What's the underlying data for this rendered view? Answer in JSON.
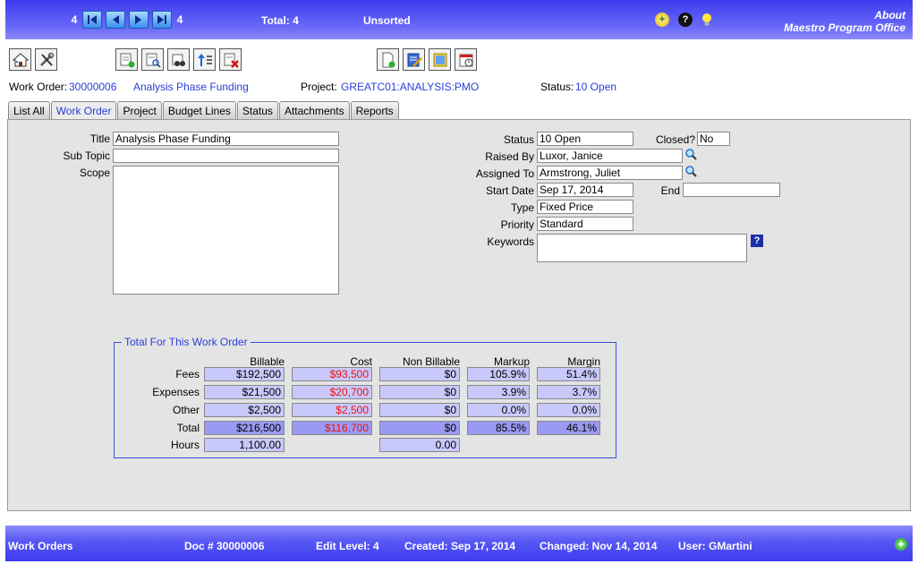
{
  "topbar": {
    "record_left": "4",
    "record_right": "4",
    "total": "Total: 4",
    "sort": "Unsorted",
    "about_line1": "About",
    "about_line2": "Maestro Program Office",
    "icons": [
      "zoom-icon",
      "help-icon",
      "lightbulb-icon"
    ]
  },
  "toolbar": {
    "left_icons": [
      "home-icon",
      "tools-icon"
    ],
    "mid_icons": [
      "add-record-icon",
      "find-record-icon",
      "binoculars-icon",
      "sort-icon",
      "delete-record-icon"
    ],
    "right_icons": [
      "new-document-icon",
      "edit-document-icon",
      "notes-icon",
      "calendar-icon"
    ]
  },
  "info": {
    "wo_label": "Work Order:",
    "wo_value": "30000006",
    "wo_title": "Analysis Phase Funding",
    "project_label": "Project:",
    "project_value": "GREATC01:ANALYSIS:PMO",
    "status_label": "Status:",
    "status_value": "10 Open"
  },
  "tabs": [
    "List All",
    "Work Order",
    "Project",
    "Budget Lines",
    "Status",
    "Attachments",
    "Reports"
  ],
  "form": {
    "title_label": "Title",
    "title_value": "Analysis Phase Funding",
    "subtopic_label": "Sub Topic",
    "subtopic_value": "",
    "scope_label": "Scope",
    "scope_value": "",
    "status_label": "Status",
    "status_value": "10 Open",
    "closed_label": "Closed?",
    "closed_value": "No",
    "raised_label": "Raised By",
    "raised_value": "Luxor, Janice",
    "assigned_label": "Assigned To",
    "assigned_value": "Armstrong, Juliet",
    "start_label": "Start Date",
    "start_value": "Sep 17, 2014",
    "end_label": "End",
    "end_value": "",
    "type_label": "Type",
    "type_value": "Fixed Price",
    "priority_label": "Priority",
    "priority_value": "Standard",
    "keywords_label": "Keywords",
    "keywords_value": "",
    "help_glyph": "?"
  },
  "totals": {
    "legend": "Total For This Work Order",
    "headers": [
      "Billable",
      "Cost",
      "Non Billable",
      "Markup",
      "Margin"
    ],
    "rows": [
      {
        "label": "Fees",
        "billable": "$192,500",
        "cost": "$93,500",
        "nonbillable": "$0",
        "markup": "105.9%",
        "margin": "51.4%"
      },
      {
        "label": "Expenses",
        "billable": "$21,500",
        "cost": "$20,700",
        "nonbillable": "$0",
        "markup": "3.9%",
        "margin": "3.7%"
      },
      {
        "label": "Other",
        "billable": "$2,500",
        "cost": "$2,500",
        "nonbillable": "$0",
        "markup": "0.0%",
        "margin": "0.0%"
      },
      {
        "label": "Total",
        "billable": "$216,500",
        "cost": "$116,700",
        "nonbillable": "$0",
        "markup": "85.5%",
        "margin": "46.1%"
      }
    ],
    "hours_label": "Hours",
    "hours_billable": "1,100.00",
    "hours_nonbillable": "0.00",
    "cost_color": "#f01010"
  },
  "status": {
    "module": "Work Orders",
    "doc": "Doc # 30000006",
    "edit_level": "Edit Level: 4",
    "created": "Created: Sep 17, 2014",
    "changed": "Changed: Nov 14, 2014",
    "user": "User: GMartini",
    "plus_glyph": "+"
  }
}
